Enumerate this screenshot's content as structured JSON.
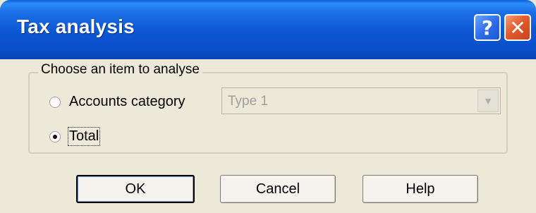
{
  "window": {
    "title": "Tax analysis",
    "help_glyph": "?",
    "close_glyph": "✕"
  },
  "group": {
    "legend": "Choose an item to analyse",
    "options": [
      {
        "label": "Accounts category",
        "selected": false
      },
      {
        "label": "Total",
        "selected": true
      }
    ],
    "combo": {
      "value": "Type 1",
      "enabled": false
    }
  },
  "buttons": {
    "ok": "OK",
    "cancel": "Cancel",
    "help": "Help"
  }
}
